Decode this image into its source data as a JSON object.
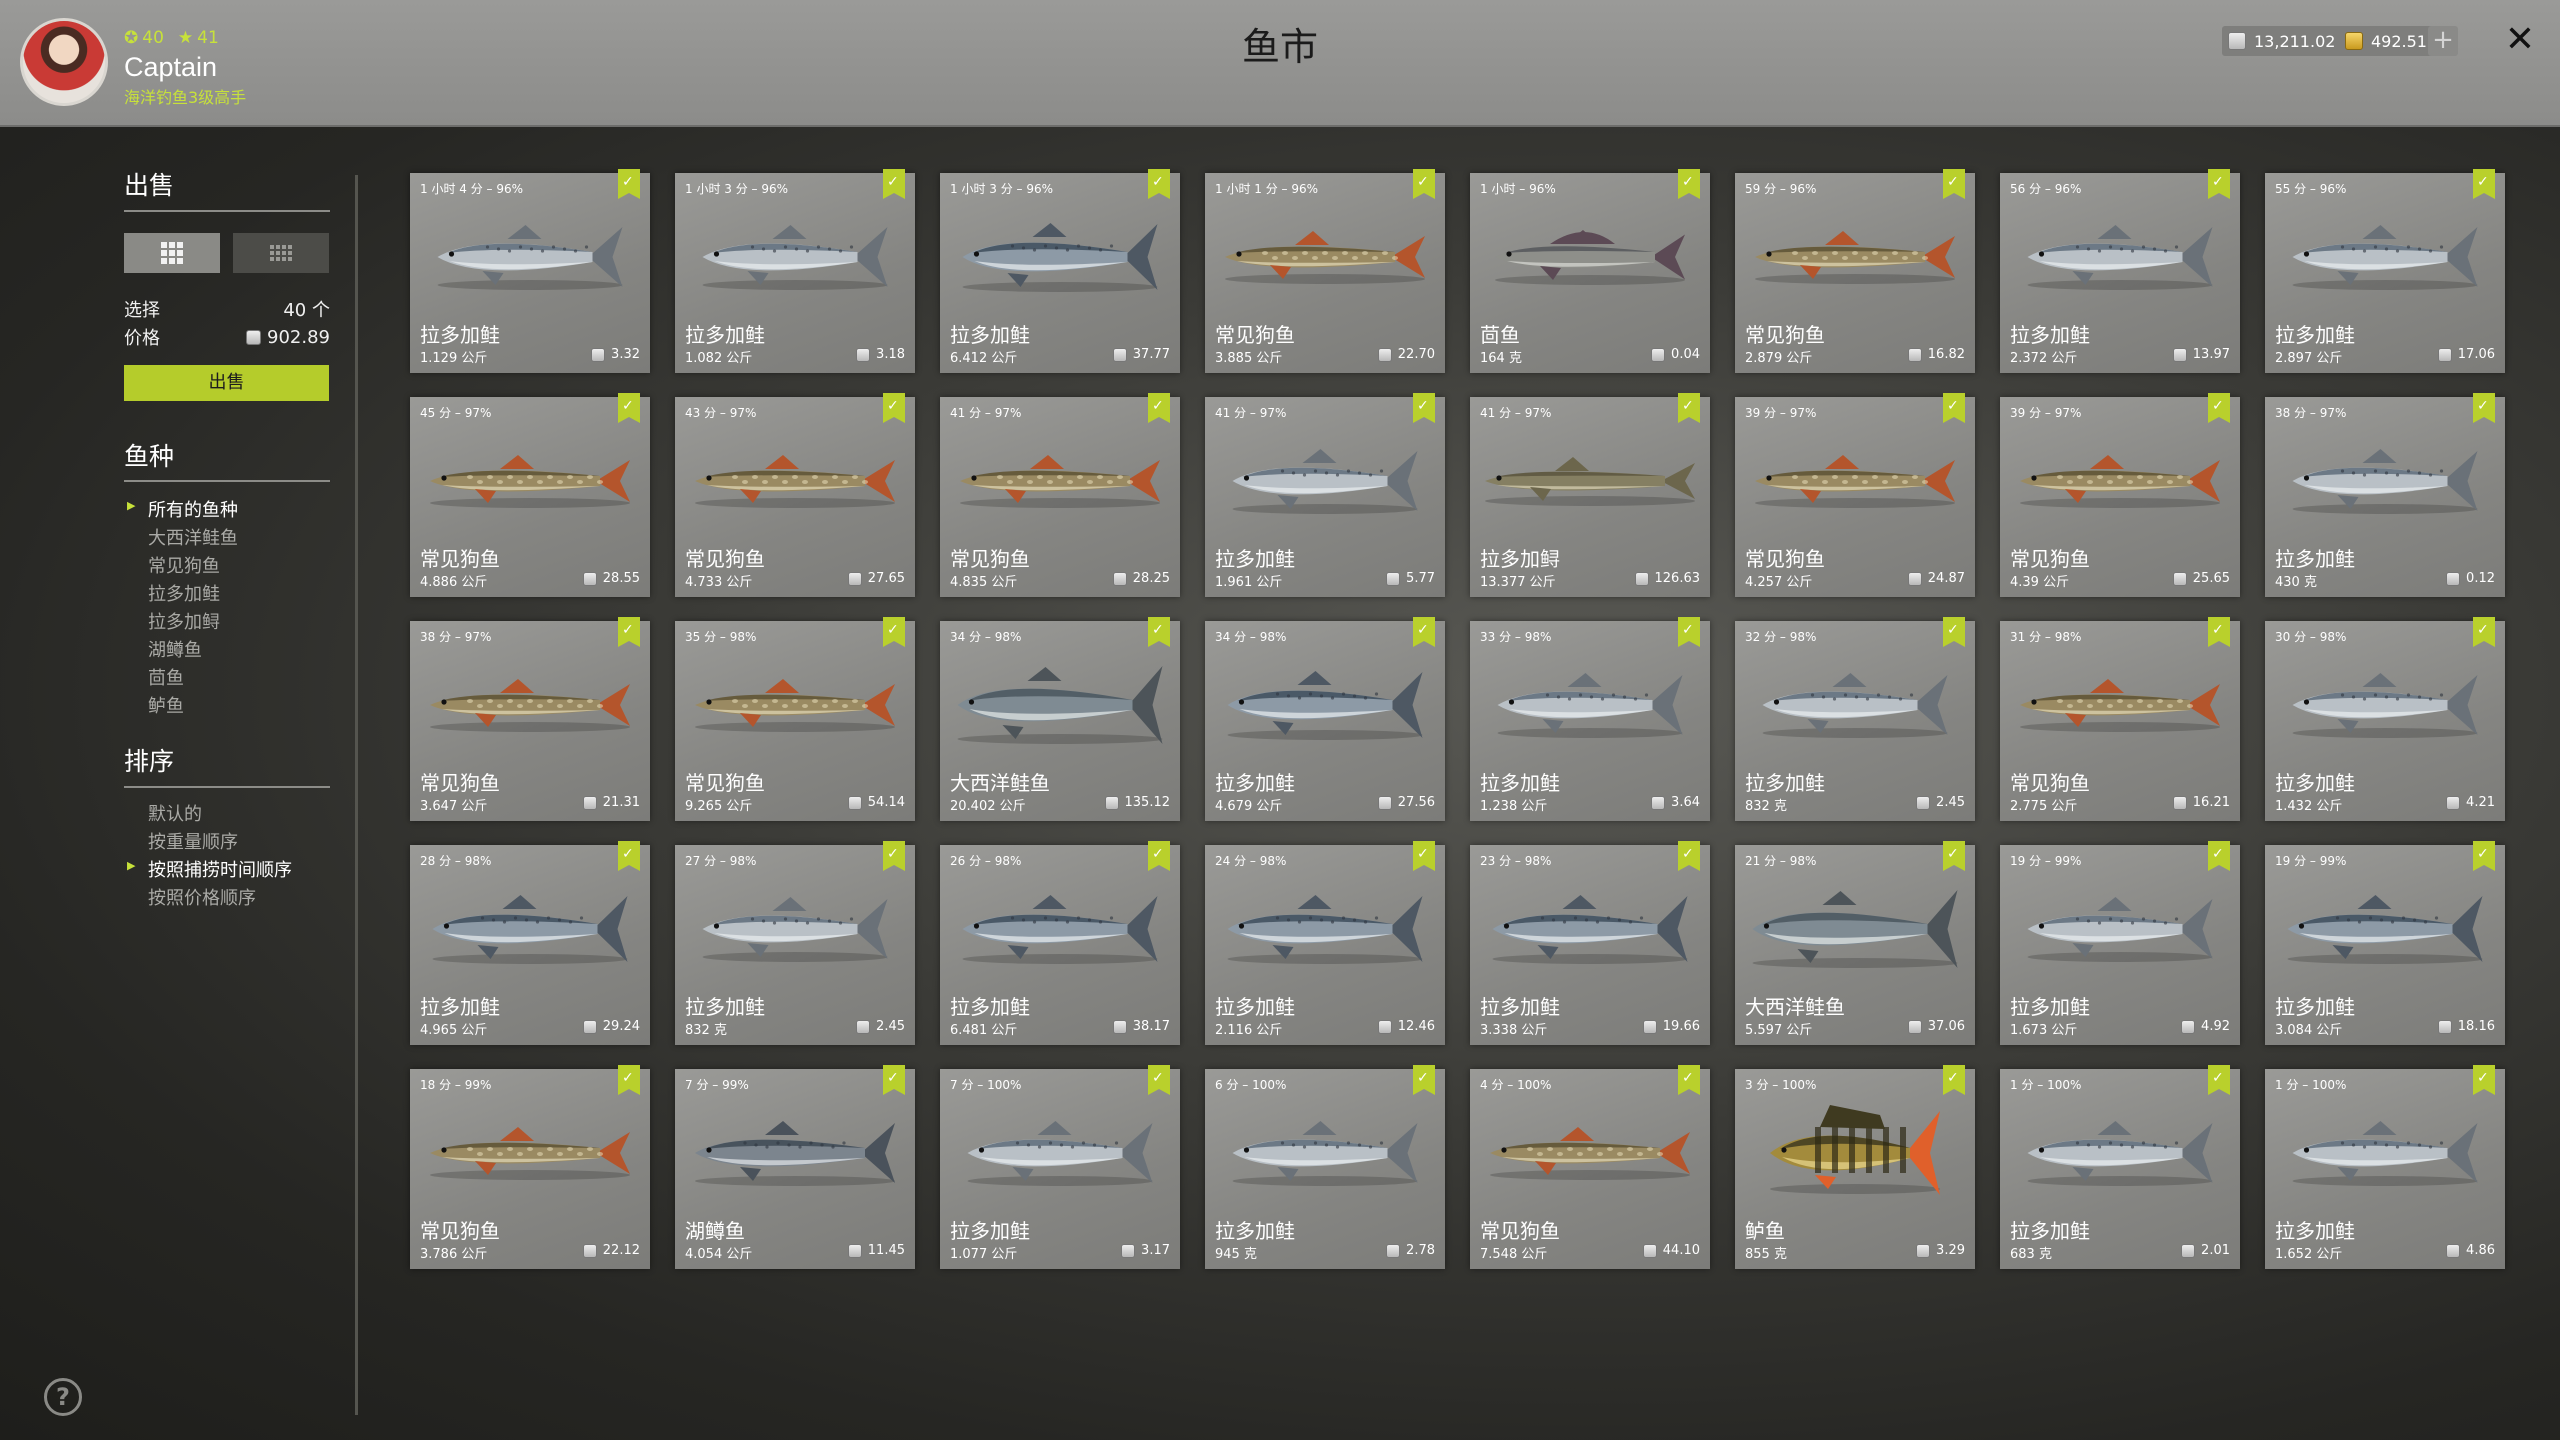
{
  "header": {
    "title": "鱼市",
    "player": {
      "level": "40",
      "rank": "41",
      "name": "Captain",
      "title": "海洋钓鱼3级高手"
    },
    "silver": "13,211.02",
    "gold": "492.51",
    "plus_label": "+",
    "close_label": "✕"
  },
  "sidebar": {
    "sell_title": "出售",
    "select_label": "选择",
    "select_value": "40 个",
    "price_label": "价格",
    "price_value": "902.89",
    "sell_button": "出售",
    "species_title": "鱼种",
    "species": [
      {
        "label": "所有的鱼种",
        "active": true
      },
      {
        "label": "大西洋鲑鱼",
        "active": false
      },
      {
        "label": "常见狗鱼",
        "active": false
      },
      {
        "label": "拉多加鲑",
        "active": false
      },
      {
        "label": "拉多加鲟",
        "active": false
      },
      {
        "label": "湖鳟鱼",
        "active": false
      },
      {
        "label": "茴鱼",
        "active": false
      },
      {
        "label": "鲈鱼",
        "active": false
      }
    ],
    "sort_title": "排序",
    "sort": [
      {
        "label": "默认的",
        "active": false
      },
      {
        "label": "按重量顺序",
        "active": false
      },
      {
        "label": "按照捕捞时间顺序",
        "active": true
      },
      {
        "label": "按照价格顺序",
        "active": false
      }
    ],
    "help_label": "?"
  },
  "colors": {
    "accent": "#b9d02c",
    "topbar": "#929290",
    "card": "#8a8a87"
  },
  "fish_cards": [
    {
      "time": "1 小时 4 分 – 96%",
      "name": "拉多加鲑",
      "weight": "1.129 公斤",
      "price": "3.32",
      "kind": "salmon"
    },
    {
      "time": "1 小时 3 分 – 96%",
      "name": "拉多加鲑",
      "weight": "1.082 公斤",
      "price": "3.18",
      "kind": "salmon"
    },
    {
      "time": "1 小时 3 分 – 96%",
      "name": "拉多加鲑",
      "weight": "6.412 公斤",
      "price": "37.77",
      "kind": "salmon_dark"
    },
    {
      "time": "1 小时 1 分 – 96%",
      "name": "常见狗鱼",
      "weight": "3.885 公斤",
      "price": "22.70",
      "kind": "pike"
    },
    {
      "time": "1 小时 – 96%",
      "name": "茴鱼",
      "weight": "164 克",
      "price": "0.04",
      "kind": "grayling"
    },
    {
      "time": "59 分 – 96%",
      "name": "常见狗鱼",
      "weight": "2.879 公斤",
      "price": "16.82",
      "kind": "pike"
    },
    {
      "time": "56 分 – 96%",
      "name": "拉多加鲑",
      "weight": "2.372 公斤",
      "price": "13.97",
      "kind": "salmon"
    },
    {
      "time": "55 分 – 96%",
      "name": "拉多加鲑",
      "weight": "2.897 公斤",
      "price": "17.06",
      "kind": "salmon"
    },
    {
      "time": "45 分 – 97%",
      "name": "常见狗鱼",
      "weight": "4.886 公斤",
      "price": "28.55",
      "kind": "pike"
    },
    {
      "time": "43 分 – 97%",
      "name": "常见狗鱼",
      "weight": "4.733 公斤",
      "price": "27.65",
      "kind": "pike"
    },
    {
      "time": "41 分 – 97%",
      "name": "常见狗鱼",
      "weight": "4.835 公斤",
      "price": "28.25",
      "kind": "pike"
    },
    {
      "time": "41 分 – 97%",
      "name": "拉多加鲑",
      "weight": "1.961 公斤",
      "price": "5.77",
      "kind": "salmon"
    },
    {
      "time": "41 分 – 97%",
      "name": "拉多加鲟",
      "weight": "13.377 公斤",
      "price": "126.63",
      "kind": "sturgeon"
    },
    {
      "time": "39 分 – 97%",
      "name": "常见狗鱼",
      "weight": "4.257 公斤",
      "price": "24.87",
      "kind": "pike"
    },
    {
      "time": "39 分 – 97%",
      "name": "常见狗鱼",
      "weight": "4.39 公斤",
      "price": "25.65",
      "kind": "pike"
    },
    {
      "time": "38 分 – 97%",
      "name": "拉多加鲑",
      "weight": "430 克",
      "price": "0.12",
      "kind": "salmon"
    },
    {
      "time": "38 分 – 97%",
      "name": "常见狗鱼",
      "weight": "3.647 公斤",
      "price": "21.31",
      "kind": "pike"
    },
    {
      "time": "35 分 – 98%",
      "name": "常见狗鱼",
      "weight": "9.265 公斤",
      "price": "54.14",
      "kind": "pike"
    },
    {
      "time": "34 分 – 98%",
      "name": "大西洋鲑鱼",
      "weight": "20.402 公斤",
      "price": "135.12",
      "kind": "atlantic"
    },
    {
      "time": "34 分 – 98%",
      "name": "拉多加鲑",
      "weight": "4.679 公斤",
      "price": "27.56",
      "kind": "salmon_dark"
    },
    {
      "time": "33 分 – 98%",
      "name": "拉多加鲑",
      "weight": "1.238 公斤",
      "price": "3.64",
      "kind": "salmon"
    },
    {
      "time": "32 分 – 98%",
      "name": "拉多加鲑",
      "weight": "832 克",
      "price": "2.45",
      "kind": "salmon"
    },
    {
      "time": "31 分 – 98%",
      "name": "常见狗鱼",
      "weight": "2.775 公斤",
      "price": "16.21",
      "kind": "pike"
    },
    {
      "time": "30 分 – 98%",
      "name": "拉多加鲑",
      "weight": "1.432 公斤",
      "price": "4.21",
      "kind": "salmon"
    },
    {
      "time": "28 分 – 98%",
      "name": "拉多加鲑",
      "weight": "4.965 公斤",
      "price": "29.24",
      "kind": "salmon_dark"
    },
    {
      "time": "27 分 – 98%",
      "name": "拉多加鲑",
      "weight": "832 克",
      "price": "2.45",
      "kind": "salmon"
    },
    {
      "time": "26 分 – 98%",
      "name": "拉多加鲑",
      "weight": "6.481 公斤",
      "price": "38.17",
      "kind": "salmon_dark"
    },
    {
      "time": "24 分 – 98%",
      "name": "拉多加鲑",
      "weight": "2.116 公斤",
      "price": "12.46",
      "kind": "salmon_dark"
    },
    {
      "time": "23 分 – 98%",
      "name": "拉多加鲑",
      "weight": "3.338 公斤",
      "price": "19.66",
      "kind": "salmon_dark"
    },
    {
      "time": "21 分 – 98%",
      "name": "大西洋鲑鱼",
      "weight": "5.597 公斤",
      "price": "37.06",
      "kind": "atlantic"
    },
    {
      "time": "19 分 – 99%",
      "name": "拉多加鲑",
      "weight": "1.673 公斤",
      "price": "4.92",
      "kind": "salmon"
    },
    {
      "time": "19 分 – 99%",
      "name": "拉多加鲑",
      "weight": "3.084 公斤",
      "price": "18.16",
      "kind": "salmon_dark"
    },
    {
      "time": "18 分 – 99%",
      "name": "常见狗鱼",
      "weight": "3.786 公斤",
      "price": "22.12",
      "kind": "pike"
    },
    {
      "time": "7 分 – 99%",
      "name": "湖鳟鱼",
      "weight": "4.054 公斤",
      "price": "11.45",
      "kind": "laketrout"
    },
    {
      "time": "7 分 – 100%",
      "name": "拉多加鲑",
      "weight": "1.077 公斤",
      "price": "3.17",
      "kind": "salmon"
    },
    {
      "time": "6 分 – 100%",
      "name": "拉多加鲑",
      "weight": "945 克",
      "price": "2.78",
      "kind": "salmon"
    },
    {
      "time": "4 分 – 100%",
      "name": "常见狗鱼",
      "weight": "7.548 公斤",
      "price": "44.10",
      "kind": "pike"
    },
    {
      "time": "3 分 – 100%",
      "name": "鲈鱼",
      "weight": "855 克",
      "price": "3.29",
      "kind": "perch"
    },
    {
      "time": "1 分 – 100%",
      "name": "拉多加鲑",
      "weight": "683 克",
      "price": "2.01",
      "kind": "salmon"
    },
    {
      "time": "1 分 – 100%",
      "name": "拉多加鲑",
      "weight": "1.652 公斤",
      "price": "4.86",
      "kind": "salmon"
    }
  ]
}
